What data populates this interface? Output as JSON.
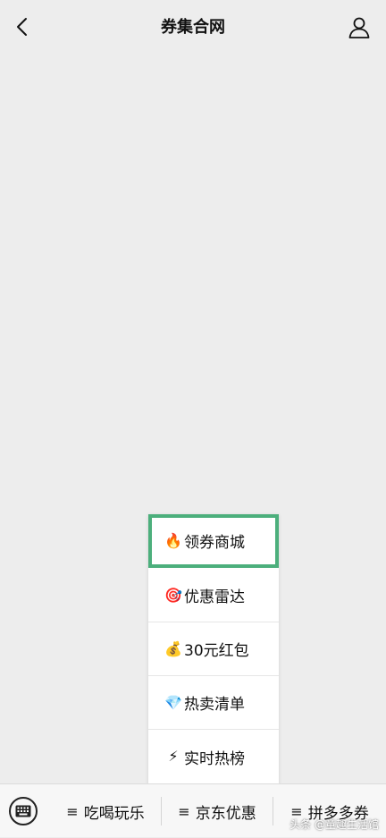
{
  "header": {
    "title": "券集合网",
    "back_icon": "chevron-left-icon",
    "profile_icon": "user-icon"
  },
  "popup_menu": {
    "items": [
      {
        "emoji": "🔥",
        "label": "领券商城"
      },
      {
        "emoji": "🎯",
        "label": "优惠雷达"
      },
      {
        "emoji": "💰",
        "label": "30元红包"
      },
      {
        "emoji": "💎",
        "label": "热卖清单"
      },
      {
        "emoji": "⚡",
        "label": "实时热榜"
      }
    ],
    "active_index": 0,
    "active_color": "#4caf7c"
  },
  "bottom_bar": {
    "keyboard_icon": "keyboard-icon",
    "tabs": [
      {
        "label": "吃喝玩乐"
      },
      {
        "label": "京东优惠"
      },
      {
        "label": "拼多多券"
      }
    ]
  },
  "watermark": "头条 @童趣生活馆"
}
